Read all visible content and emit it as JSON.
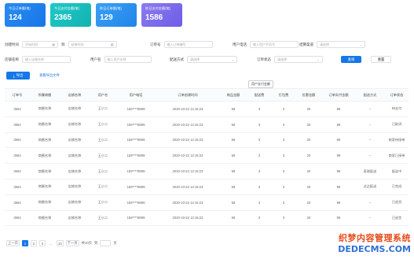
{
  "stats": [
    {
      "label": "今日订单量(笔)",
      "value": "124",
      "color": "#1677e8"
    },
    {
      "label": "今日支付金额(笔)",
      "value": "2365",
      "color": "#13b3b0"
    },
    {
      "label": "昨日订单量(笔)",
      "value": "129",
      "color": "#2185e8"
    },
    {
      "label": "昨日支付金额(笔)",
      "value": "1586",
      "color": "#6f5ce6"
    }
  ],
  "filters": {
    "created_label": "创建时间",
    "start_placeholder": "开始时间",
    "to": "到",
    "end_placeholder": "结束时间",
    "order_label": "订单号",
    "order_placeholder": "输入订单编号",
    "phone_label": "用户电话",
    "phone_placeholder": "输入用户手机号",
    "channel_label": "结算渠道",
    "channel_placeholder": "请选择",
    "shop_label": "店铺名称",
    "shop_placeholder": "输入店铺名称",
    "user_label": "用户名",
    "user_placeholder": "输入用户名称",
    "delivery_label": "配送方式",
    "delivery_placeholder": "请选择",
    "status_label": "订单状态",
    "status_placeholder": "请选择",
    "search_btn": "查询",
    "reset_btn": "重置"
  },
  "actions": {
    "export_label": "导出",
    "record_link": "查看导出文件"
  },
  "tooltip": "用户支付金额",
  "table": {
    "columns": [
      "订单号",
      "所属商圈",
      "店铺名称",
      "用户名",
      "用户电话",
      "订单创建时间",
      "商品金额",
      "配送费",
      "打包费",
      "优惠金额",
      "订单实付金额",
      "配送方式",
      "订单状态"
    ],
    "rows": [
      [
        "3564",
        "商圈名称",
        "店铺名称",
        "王小二",
        "159****8899",
        "2020-10-22 12:15:23",
        "58",
        "3",
        "3",
        "20",
        "98",
        "--",
        "待支付"
      ],
      [
        "3564",
        "商圈名称",
        "店铺名称",
        "王小二",
        "159****8899",
        "2020-10-22 12:15:23",
        "58",
        "3",
        "3",
        "20",
        "98",
        "--",
        "已取消"
      ],
      [
        "3564",
        "商圈名称",
        "店铺名称",
        "王小二",
        "159****8899",
        "2020-10-22 12:15:23",
        "58",
        "3",
        "3",
        "20",
        "98",
        "--",
        "商家待接单"
      ],
      [
        "3564",
        "商圈名称",
        "店铺名称",
        "王小二",
        "159****8899",
        "2020-10-22 12:15:23",
        "58",
        "3",
        "3",
        "20",
        "98",
        "--",
        "商家已接单"
      ],
      [
        "3564",
        "商圈名称",
        "店铺名称",
        "王小二",
        "159****8899",
        "2020-10-22 12:15:23",
        "58",
        "3",
        "3",
        "20",
        "98",
        "家政配送",
        "配送中"
      ],
      [
        "3564",
        "商圈名称",
        "店铺名称",
        "王小二",
        "159****8899",
        "2020-10-22 12:15:23",
        "58",
        "3",
        "3",
        "20",
        "98",
        "达达配送",
        "已完成"
      ],
      [
        "3564",
        "商圈名称",
        "店铺名称",
        "王小二",
        "159****8899",
        "2020-10-22 12:15:23",
        "58",
        "3",
        "3",
        "20",
        "98",
        "--",
        "已退货"
      ],
      [
        "3564",
        "商圈名称",
        "店铺名称",
        "王小二",
        "159****8899",
        "2020-10-22 12:15:23",
        "58",
        "3",
        "3",
        "20",
        "98",
        "--",
        "已退货"
      ]
    ]
  },
  "pagination": {
    "prev": "上一页",
    "pages": [
      "1",
      "2",
      "3",
      "...",
      "10"
    ],
    "next": "下一页",
    "total": "共10页",
    "goto": "到",
    "page_unit": "页"
  },
  "watermark": {
    "line1": "织梦内容管理系统",
    "line2": "DEDECMS.COM"
  }
}
